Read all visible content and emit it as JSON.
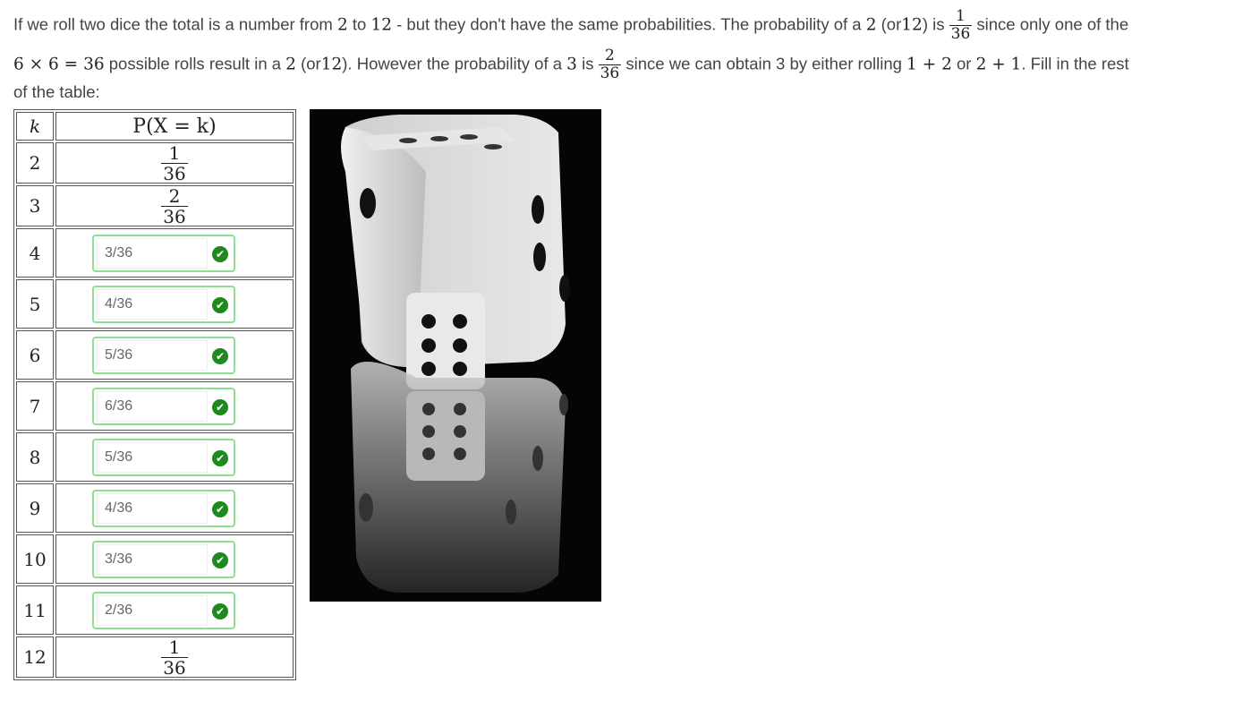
{
  "intro": {
    "l1a": "If we roll two dice the total is a number from",
    "l1b": "2",
    "l1c": "to",
    "l1d": "12",
    "l1e": "- but they don't have the same probabilities. The probability of a",
    "l1f": "2",
    "l1g": "(or",
    "l1h": "12",
    "l1i": ") is",
    "l1_frac_n": "1",
    "l1_frac_d": "36",
    "l1j": "since only one of the",
    "l2a": "6 × 6 = 36",
    "l2b": "possible rolls result in a",
    "l2c": "2",
    "l2d": "(or",
    "l2e": "12",
    "l2f": "). However the probability of a",
    "l2g": "3",
    "l2h": "is",
    "l2_frac_n": "2",
    "l2_frac_d": "36",
    "l2i": "since we can obtain 3 by either rolling",
    "l2j": "1 + 2",
    "l2k": "or",
    "l2l": "2 + 1",
    "l2m": ". Fill in the rest",
    "l3": "of the table:"
  },
  "table": {
    "col_k": "k",
    "col_p": "P(X = k)",
    "rows": [
      {
        "k": "2",
        "n": "1",
        "d": "36"
      },
      {
        "k": "3",
        "n": "2",
        "d": "36"
      },
      {
        "k": "4",
        "value": "3/36"
      },
      {
        "k": "5",
        "value": "4/36"
      },
      {
        "k": "6",
        "value": "5/36"
      },
      {
        "k": "7",
        "value": "6/36"
      },
      {
        "k": "8",
        "value": "5/36"
      },
      {
        "k": "9",
        "value": "4/36"
      },
      {
        "k": "10",
        "value": "3/36"
      },
      {
        "k": "11",
        "value": "2/36"
      },
      {
        "k": "12",
        "n": "1",
        "d": "36"
      }
    ]
  },
  "icons": {
    "correct": "checkmark-icon"
  },
  "colors": {
    "correct_border": "#90de90",
    "check": "#1e8a1e"
  }
}
